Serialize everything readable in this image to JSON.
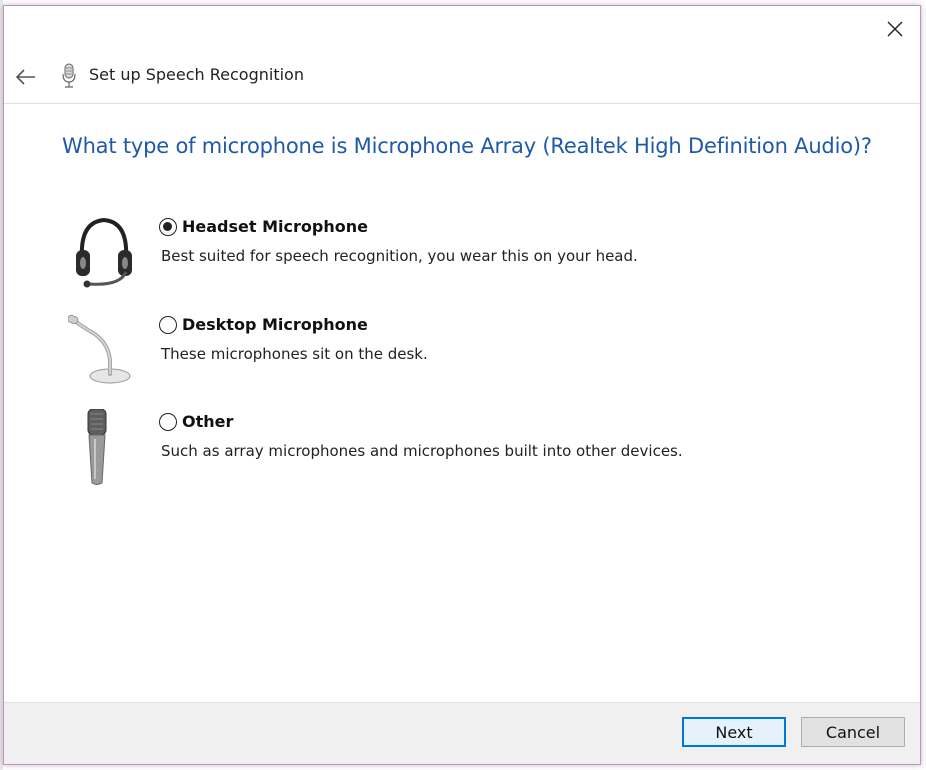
{
  "wizard": {
    "title": "Set up Speech Recognition",
    "question": "What type of microphone is Microphone Array (Realtek High Definition Audio)?"
  },
  "options": [
    {
      "label": "Headset Microphone",
      "description": "Best suited for speech recognition, you wear this on your head.",
      "selected": true,
      "icon": "headset-microphone-icon"
    },
    {
      "label": "Desktop Microphone",
      "description": "These microphones sit on the desk.",
      "selected": false,
      "icon": "desktop-microphone-icon"
    },
    {
      "label": "Other",
      "description": "Such as array microphones and microphones built into other devices.",
      "selected": false,
      "icon": "handheld-microphone-icon"
    }
  ],
  "buttons": {
    "next": "Next",
    "cancel": "Cancel"
  },
  "colors": {
    "question_text": "#1e5aa8",
    "primary_border": "#0078d7",
    "window_border": "#c88cc8",
    "footer_bg": "#f0f0f0"
  }
}
